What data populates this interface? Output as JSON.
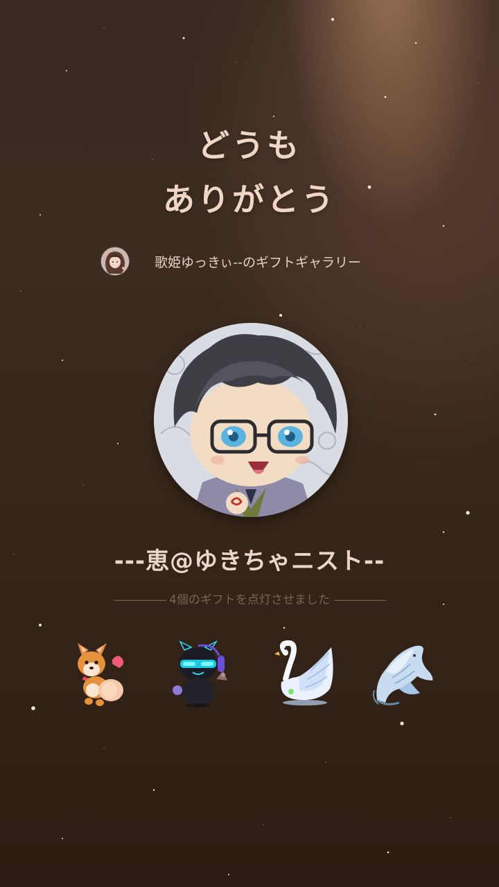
{
  "thanks": {
    "line1": "どうも",
    "line2": "ありがとう"
  },
  "gallery": {
    "title": "歌姫ゆっきぃ--のギフトギャラリー"
  },
  "user": {
    "name": "---恵@ゆきちゃニスト--"
  },
  "gift_summary": {
    "rule_left": "—————",
    "text": "4個のギフトを点灯させました",
    "rule_right": "—————"
  },
  "gifts": [
    {
      "icon": "corgi-gift-icon"
    },
    {
      "icon": "cyber-cat-gift-icon"
    },
    {
      "icon": "swan-gift-icon"
    },
    {
      "icon": "whale-gift-icon"
    }
  ],
  "colors": {
    "background_top": "#3a2a22",
    "background_bottom": "#2c1d14",
    "heading_text": "#efd6c6",
    "muted_text": "#7a6456"
  }
}
